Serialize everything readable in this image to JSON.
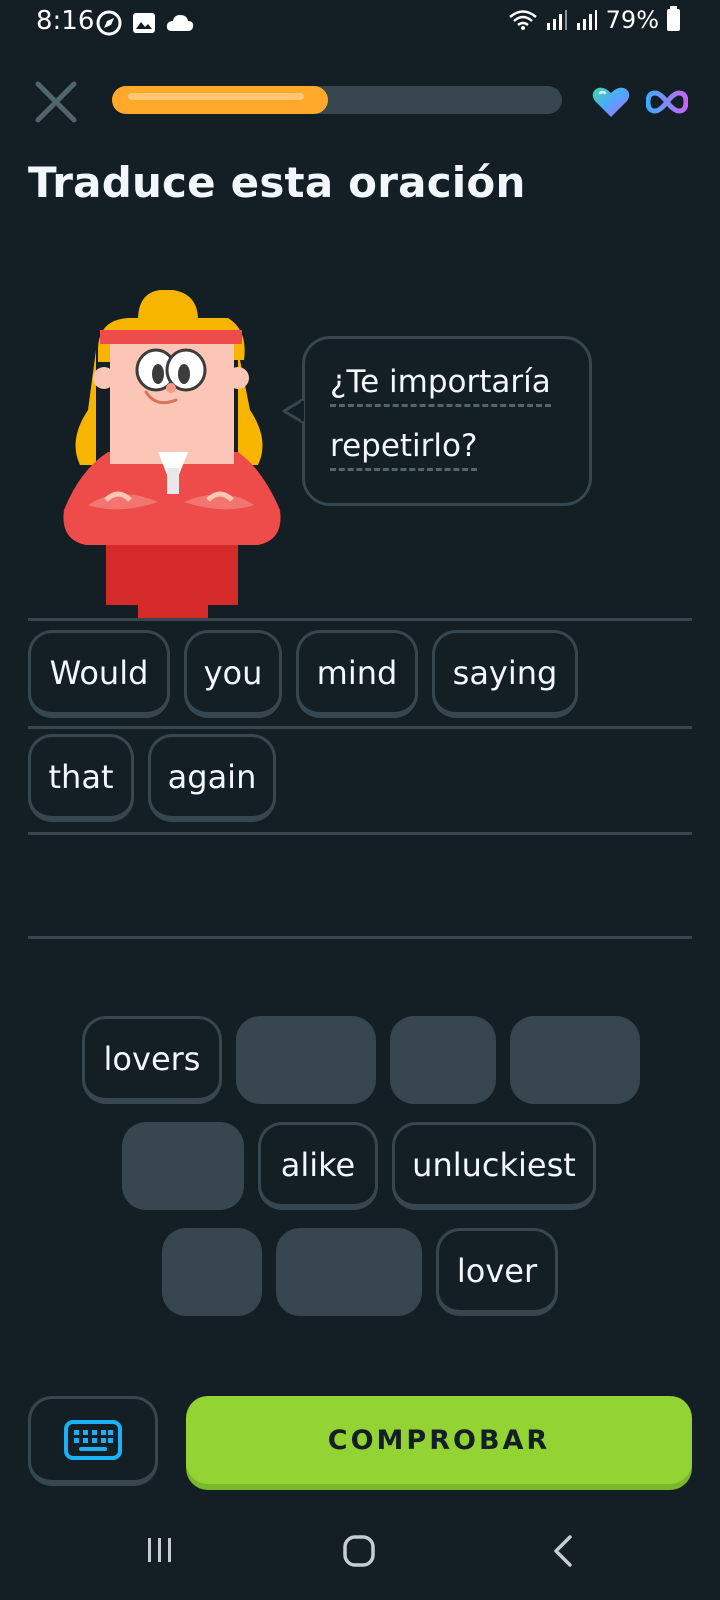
{
  "status_bar": {
    "time": "8:16",
    "battery": "79%"
  },
  "header": {
    "progress": 0.48
  },
  "title": "Traduce esta oración",
  "prompt": {
    "line1": "¿Te importaría",
    "line2": "repetirlo?"
  },
  "answer_tiles": [
    {
      "label": "Would"
    },
    {
      "label": "you"
    },
    {
      "label": "mind"
    },
    {
      "label": "saying"
    },
    {
      "label": "that"
    },
    {
      "label": "again"
    }
  ],
  "word_bank": [
    {
      "label": "lovers"
    },
    {
      "label": "alike"
    },
    {
      "label": "unluckiest"
    },
    {
      "label": "lover"
    }
  ],
  "check_button": "COMPROBAR",
  "colors": {
    "background": "#131f24",
    "accent_green": "#93d333",
    "progress": "#ffa82a",
    "tile_border": "#37464f"
  }
}
